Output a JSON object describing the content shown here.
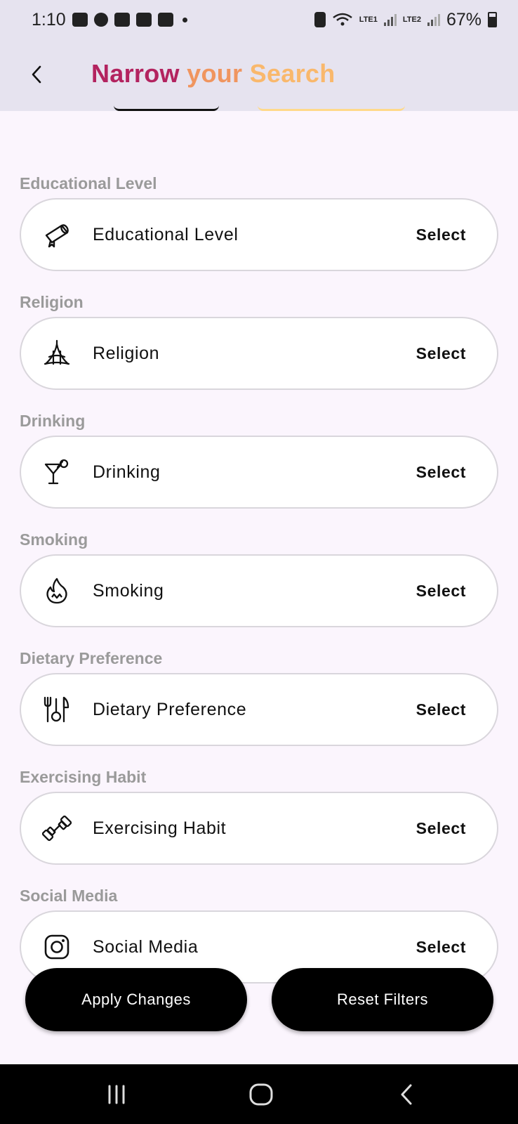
{
  "status_bar": {
    "time": "1:10",
    "lte1": "LTE1",
    "lte2": "LTE2",
    "battery": "67%"
  },
  "header": {
    "title_part1": "Narrow ",
    "title_part2": "your ",
    "title_part3": "Search"
  },
  "filters": [
    {
      "section": "Educational Level",
      "label": "Educational Level",
      "action": "Select",
      "icon": "diploma-icon"
    },
    {
      "section": "Religion",
      "label": "Religion",
      "action": "Select",
      "icon": "temple-icon"
    },
    {
      "section": "Drinking",
      "label": "Drinking",
      "action": "Select",
      "icon": "cocktail-icon"
    },
    {
      "section": "Smoking",
      "label": "Smoking",
      "action": "Select",
      "icon": "flame-icon"
    },
    {
      "section": "Dietary Preference",
      "label": "Dietary Preference",
      "action": "Select",
      "icon": "utensils-icon"
    },
    {
      "section": "Exercising Habit",
      "label": "Exercising Habit",
      "action": "Select",
      "icon": "dumbbell-icon"
    },
    {
      "section": "Social Media",
      "label": "Social Media",
      "action": "Select",
      "icon": "instagram-icon"
    }
  ],
  "actions": {
    "apply": "Apply Changes",
    "reset": "Reset Filters"
  },
  "colors": {
    "title_1": "#b3235f",
    "title_2": "#f0955f",
    "title_3": "#f9b86c",
    "header_bg": "#e6e3ef",
    "page_bg": "#fbf5fd"
  }
}
